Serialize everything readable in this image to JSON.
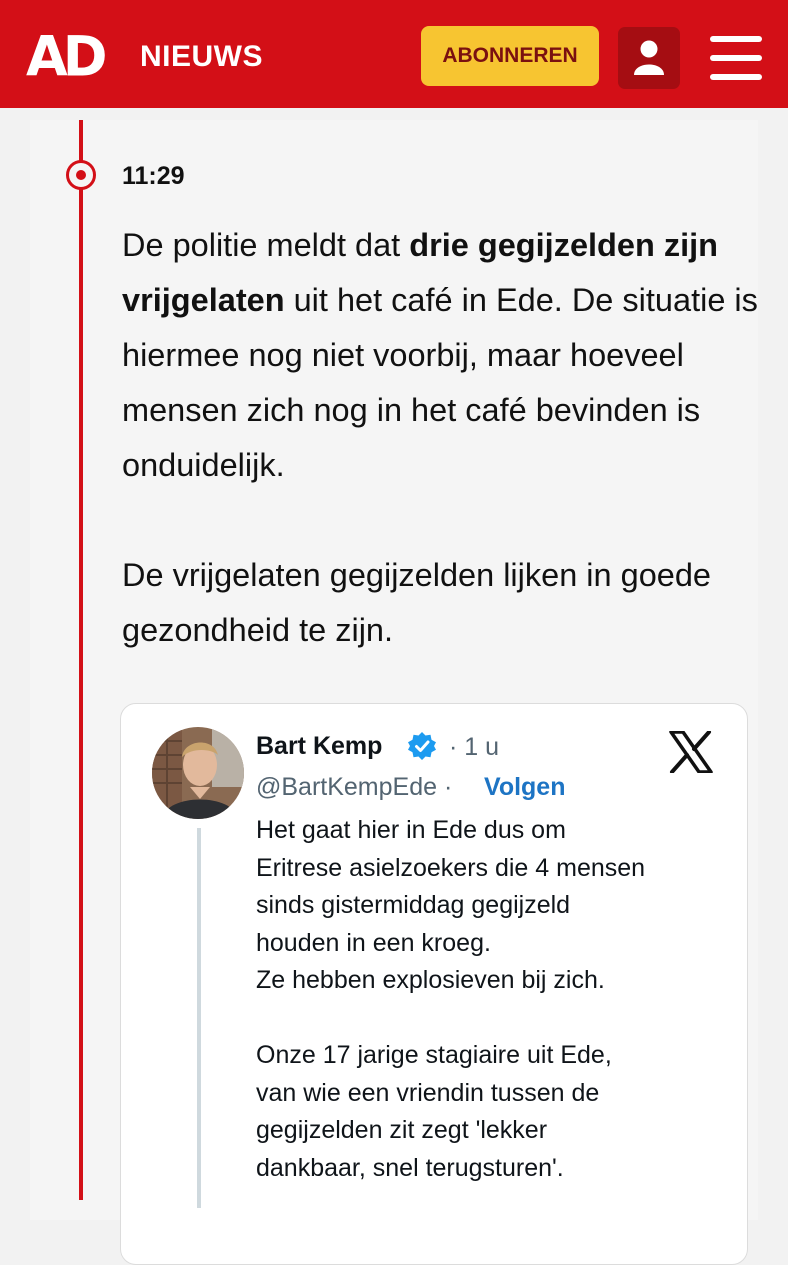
{
  "header": {
    "logo": "AD",
    "section": "NIEUWS",
    "subscribe_label": "ABONNEREN",
    "brand_color": "#d30f17",
    "accent_color": "#f7c531"
  },
  "liveblog": {
    "time": "11:29",
    "paragraph1": {
      "before": "De politie meldt dat ",
      "bold": "drie gegijzelden zijn vrijgelaten",
      "after": " uit het café in Ede. De situatie is hiermee nog niet voorbij, maar hoeveel mensen zich nog in het café bevinden is onduidelijk."
    },
    "paragraph2": "De vrijgelaten gegijzelden lijken in goede gezondheid te zijn."
  },
  "tweet": {
    "author": "Bart Kemp",
    "age": "· 1 u",
    "handle": "@BartKempEde ·",
    "follow_label": "Volgen",
    "paragraph1": "Het gaat hier in Ede dus om\nEritrese asielzoekers die 4 mensen\nsinds gistermiddag gegijzeld\nhouden in een kroeg.\nZe hebben explosieven bij zich.",
    "paragraph2": "Onze 17 jarige stagiaire uit Ede,\nvan wie een vriendin tussen de\ngegijzelden zit zegt 'lekker\ndankbaar, snel terugsturen'.",
    "verified_icon": "verified-badge-icon",
    "platform_icon": "x-logo-icon"
  }
}
